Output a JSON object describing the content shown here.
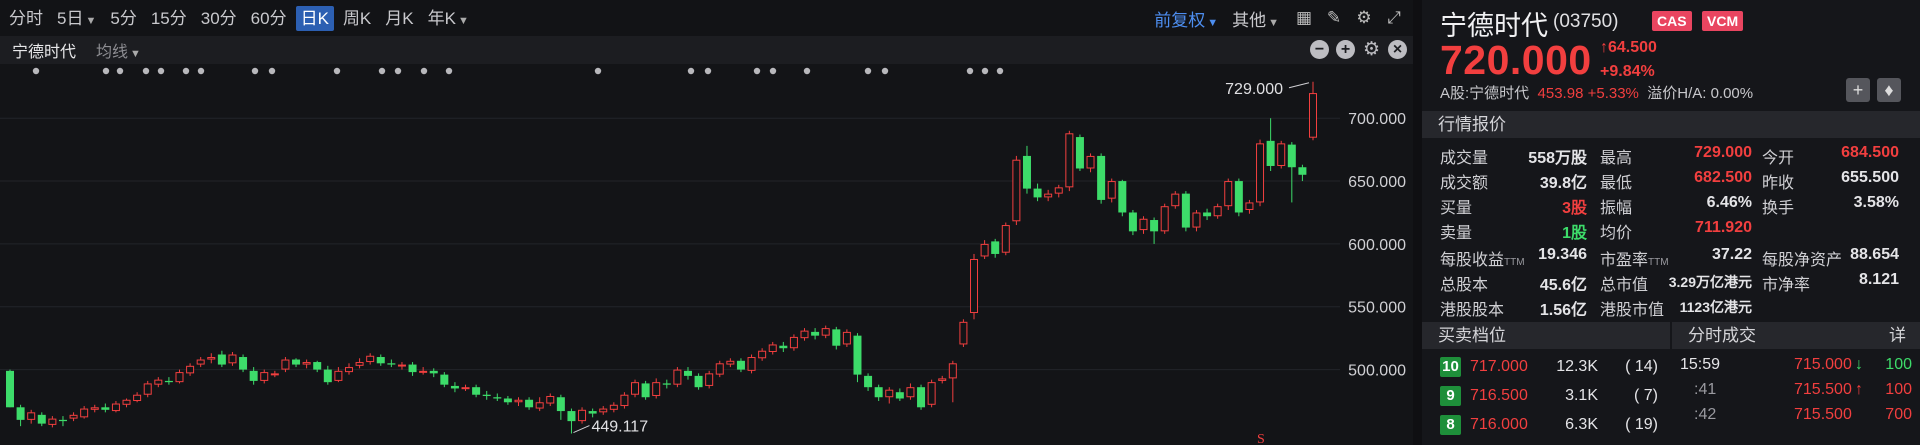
{
  "toolbar": {
    "periods": [
      "分时",
      "5日",
      "5分",
      "15分",
      "30分",
      "60分",
      "日K",
      "周K",
      "月K",
      "年K"
    ],
    "active_period": "日K",
    "adjust": "前复权",
    "other": "其他"
  },
  "subbar": {
    "name": "宁德时代",
    "indicator": "均线"
  },
  "chart_data": {
    "type": "candlestick",
    "title": "",
    "y_ticks": [
      "700.000",
      "650.000",
      "600.000",
      "550.000",
      "500.000"
    ],
    "ylim": [
      440,
      732
    ],
    "annotations": {
      "high_label": "729.000",
      "low_label": "449.117",
      "marker": "S"
    },
    "candles": [
      [
        499,
        470,
        500,
        470
      ],
      [
        470,
        460,
        472,
        455
      ],
      [
        460,
        466,
        468,
        457
      ],
      [
        464,
        457,
        466,
        455
      ],
      [
        456,
        461,
        463,
        454
      ],
      [
        460,
        459,
        463,
        455
      ],
      [
        461,
        464,
        466,
        459
      ],
      [
        462,
        469,
        471,
        461
      ],
      [
        468,
        470,
        472,
        466
      ],
      [
        470,
        468,
        473,
        466
      ],
      [
        467,
        473,
        475,
        466
      ],
      [
        472,
        476,
        477,
        470
      ],
      [
        475,
        480,
        482,
        474
      ],
      [
        480,
        489,
        491,
        478
      ],
      [
        488,
        492,
        494,
        486
      ],
      [
        491,
        490,
        494,
        488
      ],
      [
        490,
        498,
        500,
        489
      ],
      [
        497,
        503,
        505,
        495
      ],
      [
        504,
        508,
        510,
        502
      ],
      [
        508,
        510,
        513,
        505
      ],
      [
        512,
        504,
        515,
        502
      ],
      [
        505,
        512,
        514,
        503
      ],
      [
        510,
        500,
        512,
        498
      ],
      [
        499,
        491,
        502,
        488
      ],
      [
        491,
        498,
        500,
        489
      ],
      [
        497,
        497,
        499,
        494
      ],
      [
        500,
        508,
        510,
        498
      ],
      [
        508,
        504,
        509,
        502
      ],
      [
        504,
        506,
        508,
        501
      ],
      [
        506,
        500,
        507,
        498
      ],
      [
        500,
        490,
        503,
        488
      ],
      [
        491,
        499,
        502,
        490
      ],
      [
        498,
        502,
        505,
        496
      ],
      [
        503,
        506,
        509,
        501
      ],
      [
        506,
        511,
        513,
        504
      ],
      [
        510,
        505,
        512,
        503
      ],
      [
        505,
        504,
        508,
        502
      ],
      [
        503,
        504,
        506,
        500
      ],
      [
        504,
        498,
        506,
        495
      ],
      [
        498,
        499,
        502,
        496
      ],
      [
        499,
        497,
        501,
        494
      ],
      [
        496,
        488,
        498,
        486
      ],
      [
        487,
        485,
        490,
        482
      ],
      [
        485,
        486,
        488,
        483
      ],
      [
        486,
        480,
        488,
        478
      ],
      [
        480,
        479,
        483,
        476
      ],
      [
        478,
        477,
        481,
        475
      ],
      [
        477,
        474,
        479,
        472
      ],
      [
        474,
        476,
        478,
        471
      ],
      [
        476,
        470,
        478,
        468
      ],
      [
        469,
        474,
        478,
        467
      ],
      [
        473,
        479,
        481,
        471
      ],
      [
        478,
        467,
        480,
        460
      ],
      [
        467,
        459,
        469,
        449.117
      ],
      [
        459,
        468,
        470,
        457
      ],
      [
        467,
        465,
        469,
        462
      ],
      [
        466,
        469,
        471,
        464
      ],
      [
        468,
        472,
        474,
        466
      ],
      [
        471,
        480,
        482,
        469
      ],
      [
        480,
        490,
        492,
        478
      ],
      [
        489,
        478,
        491,
        476
      ],
      [
        479,
        490,
        493,
        477
      ],
      [
        489,
        488,
        492,
        485
      ],
      [
        488,
        500,
        502,
        486
      ],
      [
        499,
        495,
        502,
        492
      ],
      [
        495,
        486,
        497,
        484
      ],
      [
        487,
        497,
        499,
        485
      ],
      [
        496,
        505,
        507,
        494
      ],
      [
        504,
        507,
        509,
        502
      ],
      [
        507,
        500,
        509,
        498
      ],
      [
        499,
        510,
        512,
        497
      ],
      [
        509,
        515,
        517,
        507
      ],
      [
        514,
        520,
        522,
        512
      ],
      [
        519,
        517,
        522,
        514
      ],
      [
        517,
        526,
        528,
        515
      ],
      [
        525,
        531,
        533,
        523
      ],
      [
        530,
        527,
        533,
        524
      ],
      [
        527,
        533,
        535,
        525
      ],
      [
        532,
        519,
        534,
        516
      ],
      [
        520,
        530,
        532,
        518
      ],
      [
        527,
        496,
        529,
        490
      ],
      [
        495,
        486,
        497,
        483
      ],
      [
        486,
        478,
        488,
        475
      ],
      [
        478,
        484,
        486,
        473
      ],
      [
        482,
        477,
        485,
        475
      ],
      [
        478,
        486,
        489,
        476
      ],
      [
        486,
        470,
        488,
        468
      ],
      [
        472,
        490,
        492,
        470
      ],
      [
        491,
        493,
        495,
        489
      ],
      [
        493,
        505,
        507,
        474
      ],
      [
        520,
        538,
        540,
        518
      ],
      [
        545,
        588,
        592,
        540
      ],
      [
        590,
        600,
        603,
        588
      ],
      [
        602,
        592,
        604,
        589
      ],
      [
        593,
        615,
        617,
        591
      ],
      [
        618,
        667,
        670,
        615
      ],
      [
        670,
        644,
        678,
        640
      ],
      [
        644,
        637,
        648,
        634
      ],
      [
        637,
        640,
        643,
        634
      ],
      [
        640,
        645,
        647,
        637
      ],
      [
        645,
        688,
        690,
        642
      ],
      [
        685,
        660,
        687,
        658
      ],
      [
        660,
        670,
        672,
        657
      ],
      [
        670,
        635,
        672,
        632
      ],
      [
        636,
        650,
        652,
        633
      ],
      [
        650,
        625,
        651,
        622
      ],
      [
        625,
        610,
        627,
        607
      ],
      [
        611,
        620,
        622,
        608
      ],
      [
        619,
        610,
        621,
        600
      ],
      [
        610,
        630,
        632,
        608
      ],
      [
        630,
        640,
        642,
        628
      ],
      [
        640,
        613,
        642,
        610
      ],
      [
        613,
        625,
        627,
        610
      ],
      [
        625,
        622,
        628,
        619
      ],
      [
        622,
        630,
        632,
        620
      ],
      [
        630,
        650,
        652,
        627
      ],
      [
        650,
        625,
        652,
        622
      ],
      [
        627,
        633,
        635,
        624
      ],
      [
        633,
        680,
        683,
        630
      ],
      [
        682,
        662,
        700,
        658
      ],
      [
        662,
        680,
        682,
        660
      ],
      [
        679,
        661,
        681,
        633
      ],
      [
        661,
        655,
        663,
        650
      ],
      [
        684.5,
        720,
        729,
        682.5
      ]
    ]
  },
  "dots": [
    36,
    106,
    120,
    146,
    161,
    186,
    201,
    255,
    272,
    337,
    382,
    398,
    424,
    449,
    598,
    691,
    708,
    757,
    773,
    807,
    868,
    885,
    970,
    985,
    1000
  ],
  "quote": {
    "name": "宁德时代",
    "code": "(03750)",
    "tags": [
      "CAS",
      "VCM"
    ],
    "price": "720.000",
    "change": "64.500",
    "change_pct": "+9.84%",
    "a_share": {
      "label": "A股:宁德时代",
      "price": "453.98",
      "pct": "+5.33%",
      "premium": "溢价H/A: 0.00%"
    },
    "section_title": "行情报价",
    "rows": [
      [
        {
          "l": "成交量",
          "v": "558万股",
          "c": ""
        },
        {
          "l": "最高",
          "v": "729.000",
          "c": "red"
        },
        {
          "l": "今开",
          "v": "684.500",
          "c": "red"
        }
      ],
      [
        {
          "l": "成交额",
          "v": "39.8亿",
          "c": ""
        },
        {
          "l": "最低",
          "v": "682.500",
          "c": "red"
        },
        {
          "l": "昨收",
          "v": "655.500",
          "c": ""
        }
      ],
      [
        {
          "l": "买量",
          "v": "3股",
          "c": "red"
        },
        {
          "l": "振幅",
          "v": "6.46%",
          "c": ""
        },
        {
          "l": "换手",
          "v": "3.58%",
          "c": ""
        }
      ],
      [
        {
          "l": "卖量",
          "v": "1股",
          "c": "green"
        },
        {
          "l": "均价",
          "v": "711.920",
          "c": "red"
        },
        {
          "l": "",
          "v": "",
          "c": ""
        }
      ]
    ],
    "rows2": [
      [
        {
          "l": "每股收益",
          "s": "TTM",
          "v": "19.346"
        },
        {
          "l": "市盈率",
          "s": "TTM",
          "v": "37.22"
        },
        {
          "l": "每股净资产",
          "s": "",
          "v": "88.654"
        }
      ],
      [
        {
          "l": "总股本",
          "s": "",
          "v": "45.6亿"
        },
        {
          "l": "总市值",
          "s": "",
          "v": "3.29万亿港元"
        },
        {
          "l": "市净率",
          "s": "",
          "v": "8.121"
        }
      ],
      [
        {
          "l": "港股股本",
          "s": "",
          "v": "1.56亿"
        },
        {
          "l": "港股市值",
          "s": "",
          "v": "1123亿港元"
        },
        {
          "l": "",
          "s": "",
          "v": ""
        }
      ]
    ]
  },
  "order_book": {
    "title": "买卖档位",
    "levels": [
      {
        "lvl": "10",
        "price": "717.000",
        "qty": "12.3K",
        "cnt": "( 14)"
      },
      {
        "lvl": "9",
        "price": "716.500",
        "qty": "3.1K",
        "cnt": "( 7)"
      },
      {
        "lvl": "8",
        "price": "716.000",
        "qty": "6.3K",
        "cnt": "( 19)"
      }
    ]
  },
  "ticks": {
    "title": "分时成交",
    "detail": "详",
    "rows": [
      {
        "time": "15:59",
        "price": "715.000",
        "arrow": "↓",
        "vol": "100",
        "pc": "red",
        "ac": "green",
        "vc": "green"
      },
      {
        "time": ":41",
        "price": "715.500",
        "arrow": "↑",
        "vol": "100",
        "pc": "red",
        "ac": "red",
        "vc": "red"
      },
      {
        "time": ":42",
        "price": "715.500",
        "arrow": "",
        "vol": "700",
        "pc": "red",
        "ac": "red",
        "vc": "red"
      }
    ]
  }
}
